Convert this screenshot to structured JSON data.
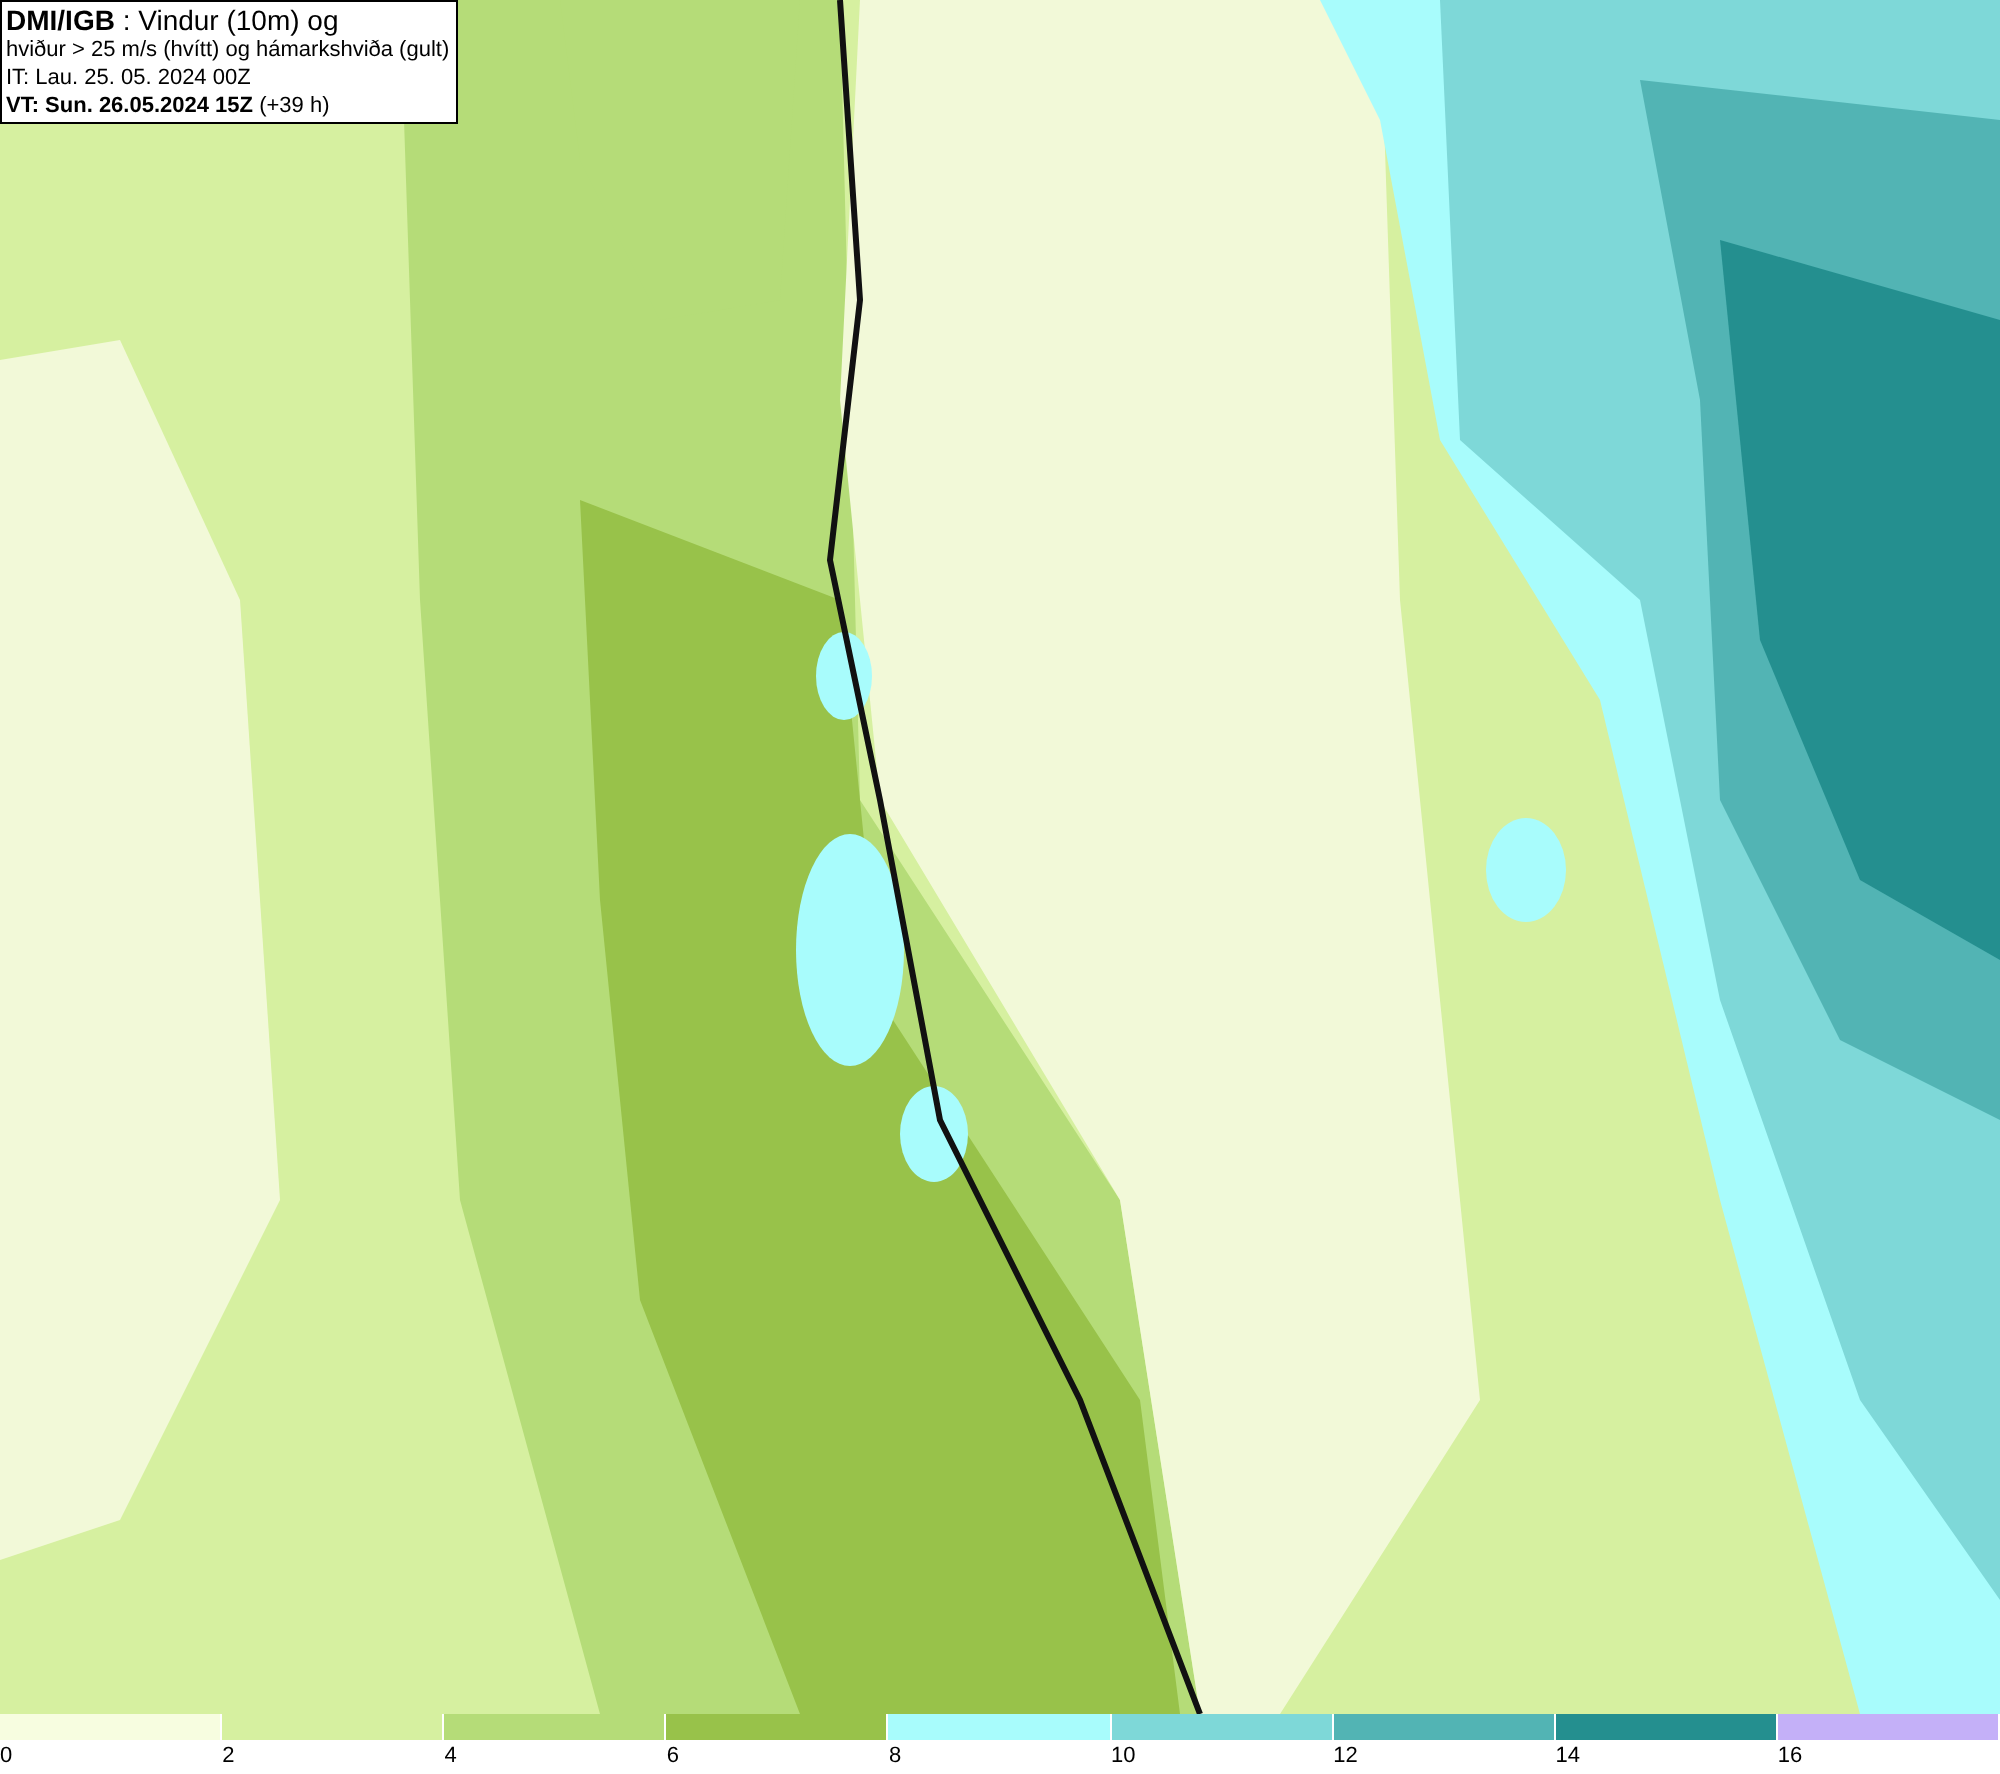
{
  "title_box": {
    "lines": [
      "**DMI/IGB** : Vindur (10m) og",
      "hviður > 25 m/s (hvítt) og hámarkshviða (gult)",
      "IT: Lau. 25. 05. 2024 00Z",
      "**VT: Sun. 26.05.2024 15Z** (+39 h)"
    ]
  },
  "legend": [
    {
      "label": "0",
      "color": "#f7fde0"
    },
    {
      "label": "2",
      "color": "#d6f0a0"
    },
    {
      "label": "4",
      "color": "#b5dc78"
    },
    {
      "label": "6",
      "color": "#98c24a"
    },
    {
      "label": "8",
      "color": "#a8fcfc"
    },
    {
      "label": "10",
      "color": "#7ed8d8"
    },
    {
      "label": "12",
      "color": "#52b4b4"
    },
    {
      "label": "14",
      "color": "#248f8f"
    },
    {
      "label": "16",
      "color": "#c4b0f8"
    }
  ]
}
